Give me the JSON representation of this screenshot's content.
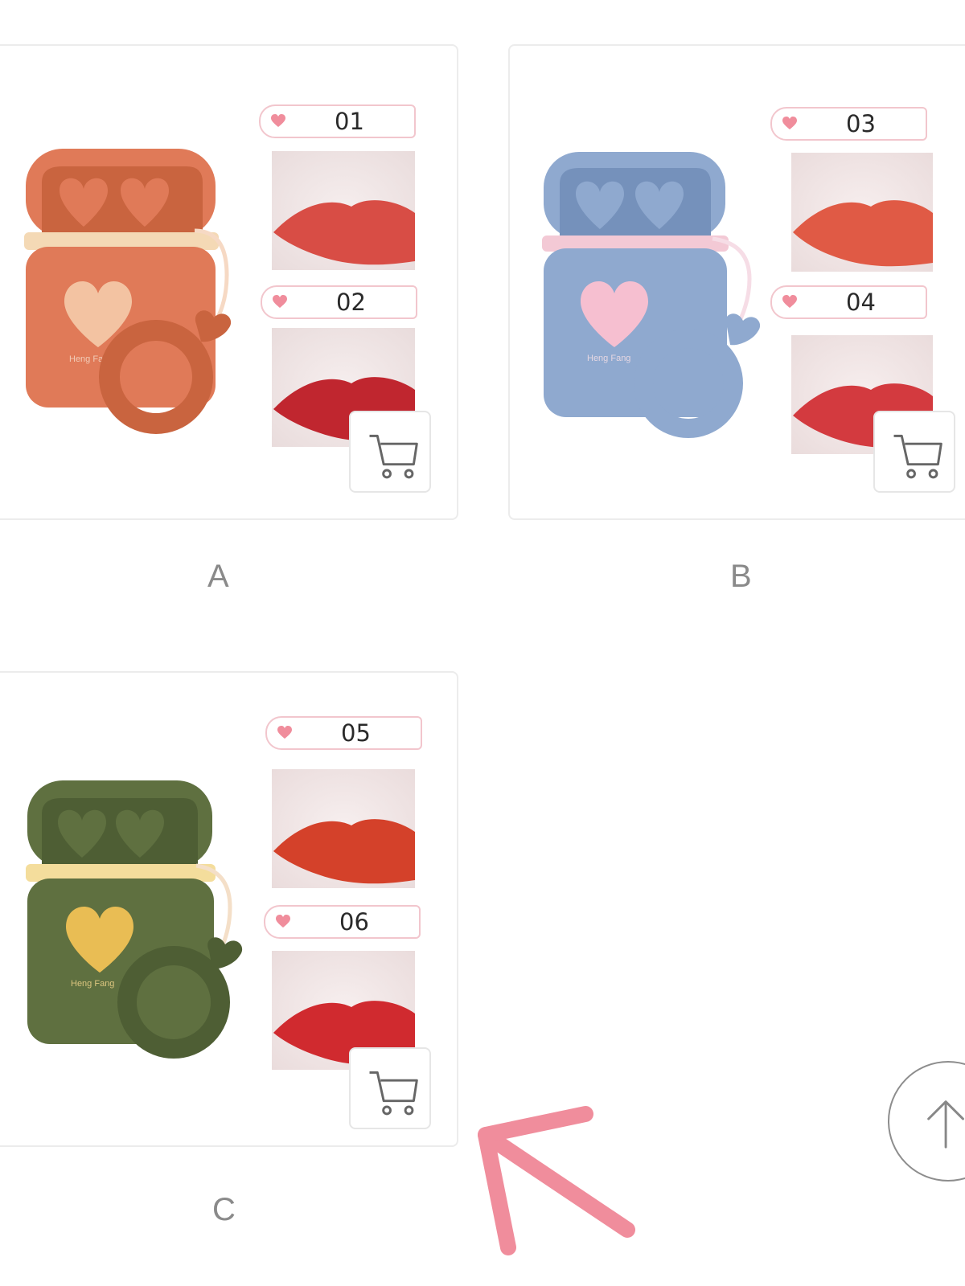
{
  "products": [
    {
      "label": "A",
      "case_color": "#e07a58",
      "case_dark": "#c9643f",
      "case_collar": "#f4d9b5",
      "heart_color": "#f3c3a2",
      "shades": [
        {
          "number": "01",
          "lip_color": "#d84d45"
        },
        {
          "number": "02",
          "lip_color": "#c0262f"
        }
      ]
    },
    {
      "label": "B",
      "case_color": "#8fa9cf",
      "case_dark": "#7591bb",
      "case_collar": "#f3c9d5",
      "heart_color": "#f6bfd0",
      "shades": [
        {
          "number": "03",
          "lip_color": "#e05a45"
        },
        {
          "number": "04",
          "lip_color": "#d33a3f"
        }
      ]
    },
    {
      "label": "C",
      "case_color": "#5f7040",
      "case_dark": "#4e5e34",
      "case_collar": "#f4dd9c",
      "heart_color": "#e9bd54",
      "shades": [
        {
          "number": "05",
          "lip_color": "#d4412a"
        },
        {
          "number": "06",
          "lip_color": "#d02a2f"
        }
      ]
    }
  ],
  "icons": {
    "cart": "cart-icon",
    "heart": "heart-icon",
    "scroll_top": "arrow-up-icon",
    "annotation": "arrow-icon"
  },
  "colors": {
    "accent_pink": "#f08d9c",
    "tag_border": "#f2c6cd"
  }
}
